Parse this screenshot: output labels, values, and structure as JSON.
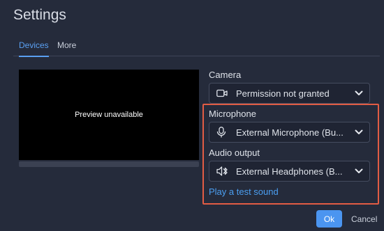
{
  "window": {
    "title": "Settings"
  },
  "tabs": [
    {
      "label": "Devices",
      "active": true
    },
    {
      "label": "More",
      "active": false
    }
  ],
  "preview": {
    "text": "Preview unavailable"
  },
  "camera": {
    "label": "Camera",
    "value": "Permission not granted",
    "icon": "camera-icon"
  },
  "microphone": {
    "label": "Microphone",
    "value": "External Microphone (Bu...",
    "icon": "microphone-icon"
  },
  "audio_output": {
    "label": "Audio output",
    "value": "External Headphones (B...",
    "icon": "bluetooth-headphones-icon"
  },
  "test_sound": {
    "label": "Play a test sound"
  },
  "buttons": {
    "ok": "Ok",
    "cancel": "Cancel"
  },
  "colors": {
    "accent": "#4b95f0",
    "highlight": "#e25c44",
    "background": "#252b3b"
  }
}
